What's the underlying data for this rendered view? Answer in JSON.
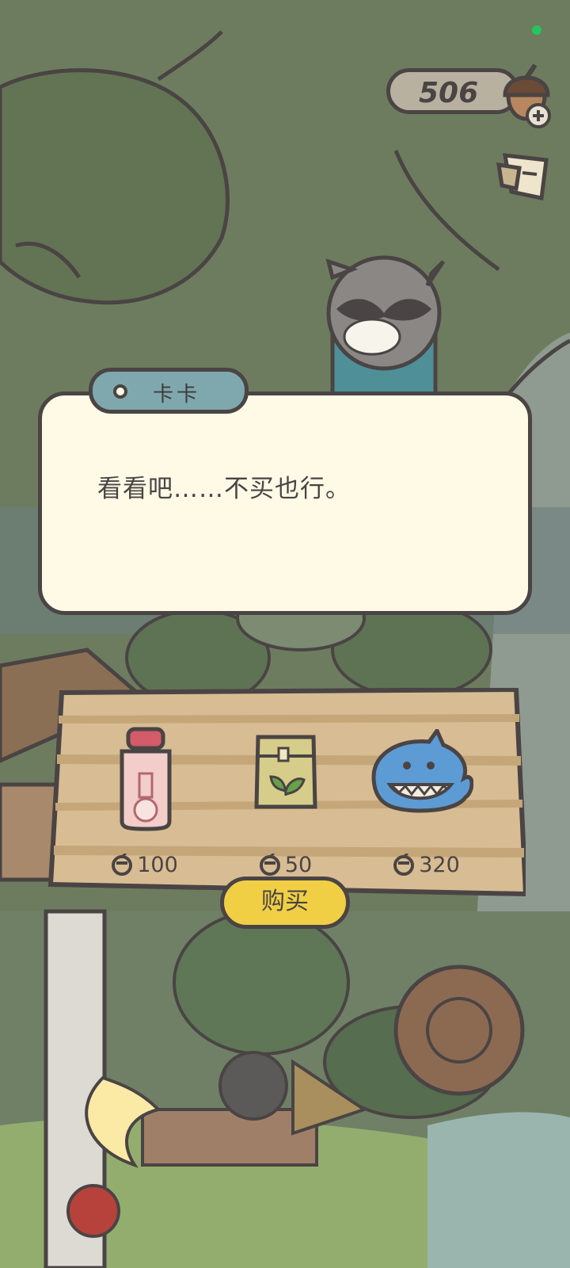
{
  "hud": {
    "acorn_count": "506",
    "acorn_icon": "acorn-plus-icon",
    "secondary_icon": "cup-icon"
  },
  "dialog": {
    "speaker": "卡卡",
    "text": "看看吧……不买也行。"
  },
  "shop": {
    "items": [
      {
        "icon": "bottle-icon",
        "price": "100"
      },
      {
        "icon": "seed-bag-icon",
        "price": "50"
      },
      {
        "icon": "shark-hat-icon",
        "price": "320"
      }
    ],
    "buy_label": "购买"
  },
  "colors": {
    "outline": "#4a4444",
    "dialog_bg": "#fefae6",
    "nametag": "#7ea8ad",
    "button": "#f1cf45",
    "board": "#d8bc93",
    "foliage": "#6d7c5e"
  }
}
